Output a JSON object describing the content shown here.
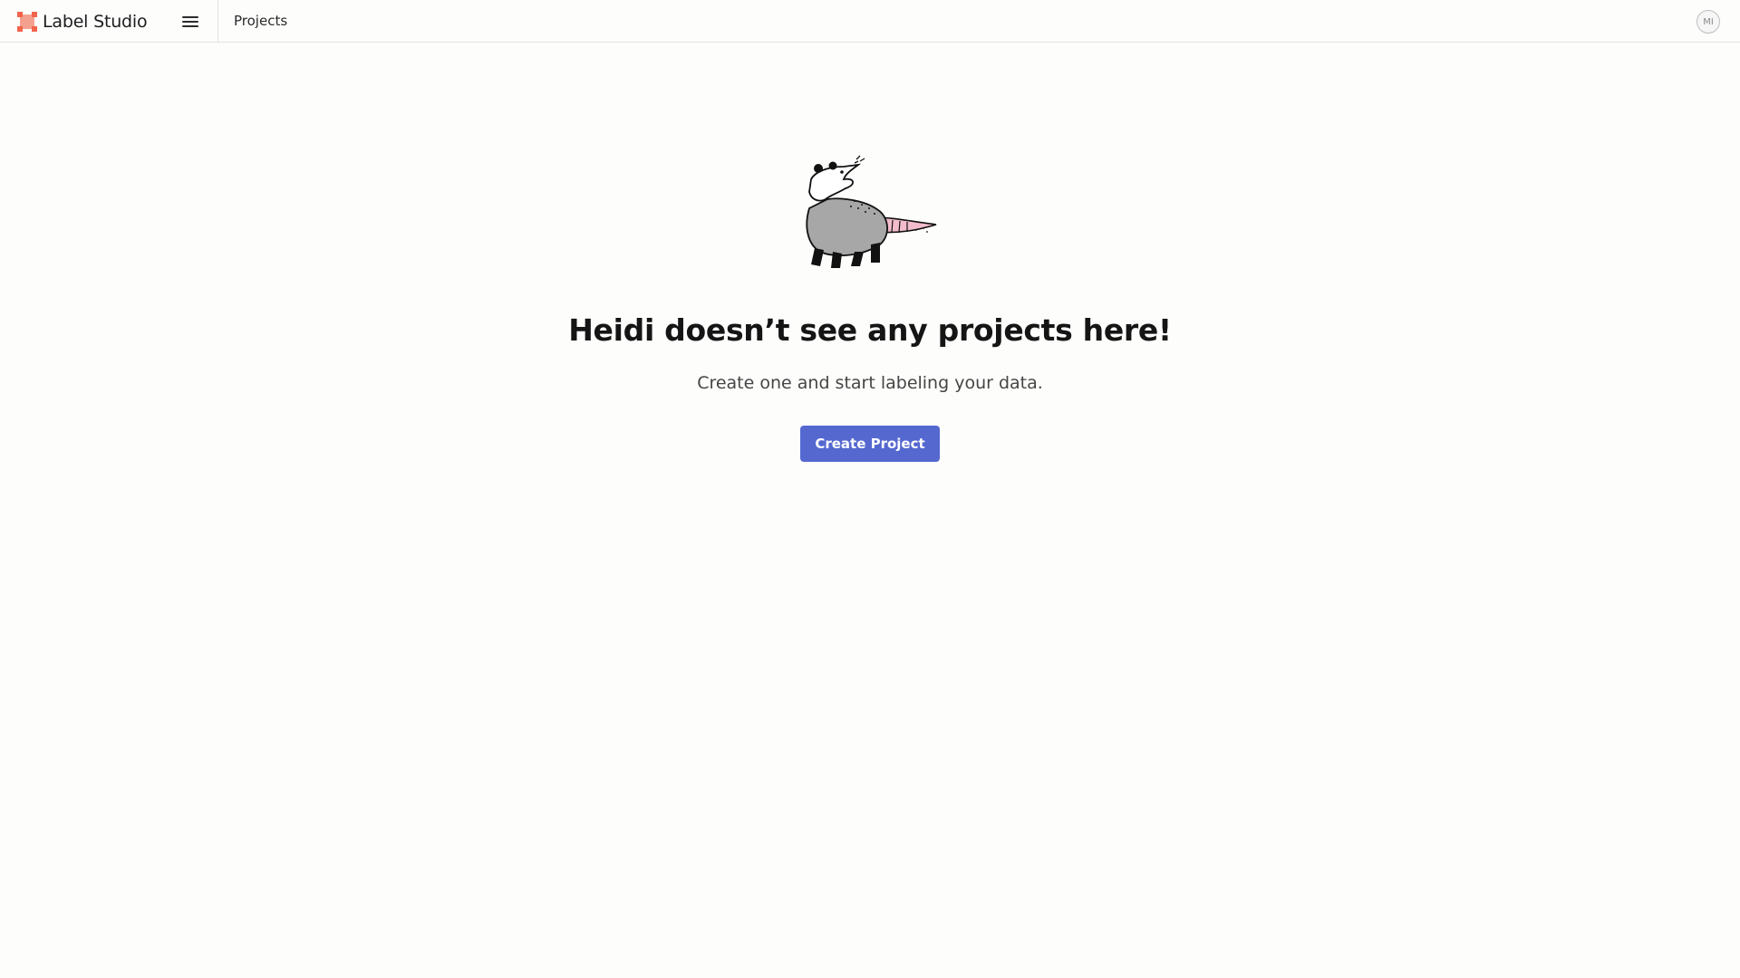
{
  "app": {
    "name": "Label Studio",
    "brand_color": "#f2644b",
    "logo_icon": "label-studio-logo-icon"
  },
  "header": {
    "menu_icon": "hamburger-menu-icon",
    "breadcrumb": "Projects",
    "avatar_initials": "MI"
  },
  "empty_state": {
    "illustration": "opossum-illustration",
    "title": "Heidi doesn’t see any projects here!",
    "subtitle": "Create one and start labeling your data.",
    "create_button_label": "Create Project",
    "button_color": "#5568d0"
  }
}
